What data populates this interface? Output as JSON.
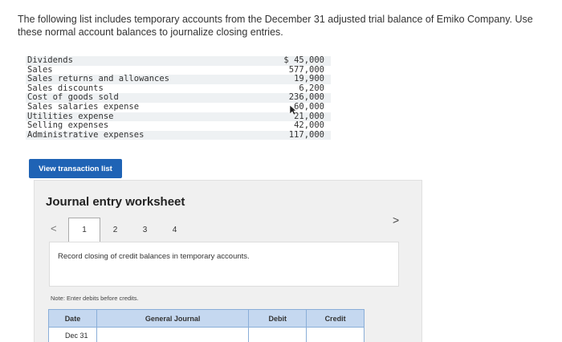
{
  "intro_text": "The following list includes temporary accounts from the December 31 adjusted trial balance of Emiko Company. Use these normal account balances to journalize closing entries.",
  "accounts": [
    {
      "name": "Dividends",
      "amount": "$ 45,000"
    },
    {
      "name": "Sales",
      "amount": "577,000"
    },
    {
      "name": "Sales returns and allowances",
      "amount": "19,900"
    },
    {
      "name": "Sales discounts",
      "amount": "6,200"
    },
    {
      "name": "Cost of goods sold",
      "amount": "236,000"
    },
    {
      "name": "Sales salaries expense",
      "amount": "60,000"
    },
    {
      "name": "Utilities expense",
      "amount": "21,000"
    },
    {
      "name": "Selling expenses",
      "amount": "42,000"
    },
    {
      "name": "Administrative expenses",
      "amount": "117,000"
    }
  ],
  "view_button_label": "View transaction list",
  "worksheet": {
    "title": "Journal entry worksheet",
    "prev_arrow": "<",
    "next_arrow": ">",
    "tabs": [
      "1",
      "2",
      "3",
      "4"
    ],
    "active_tab": "1",
    "instruction": "Record closing of credit balances in temporary accounts.",
    "note": "Note: Enter debits before credits."
  },
  "journal": {
    "headers": {
      "date": "Date",
      "general_journal": "General Journal",
      "debit": "Debit",
      "credit": "Credit"
    },
    "rows": [
      {
        "date": "Dec 31",
        "account": "",
        "debit": "",
        "credit": ""
      }
    ]
  }
}
